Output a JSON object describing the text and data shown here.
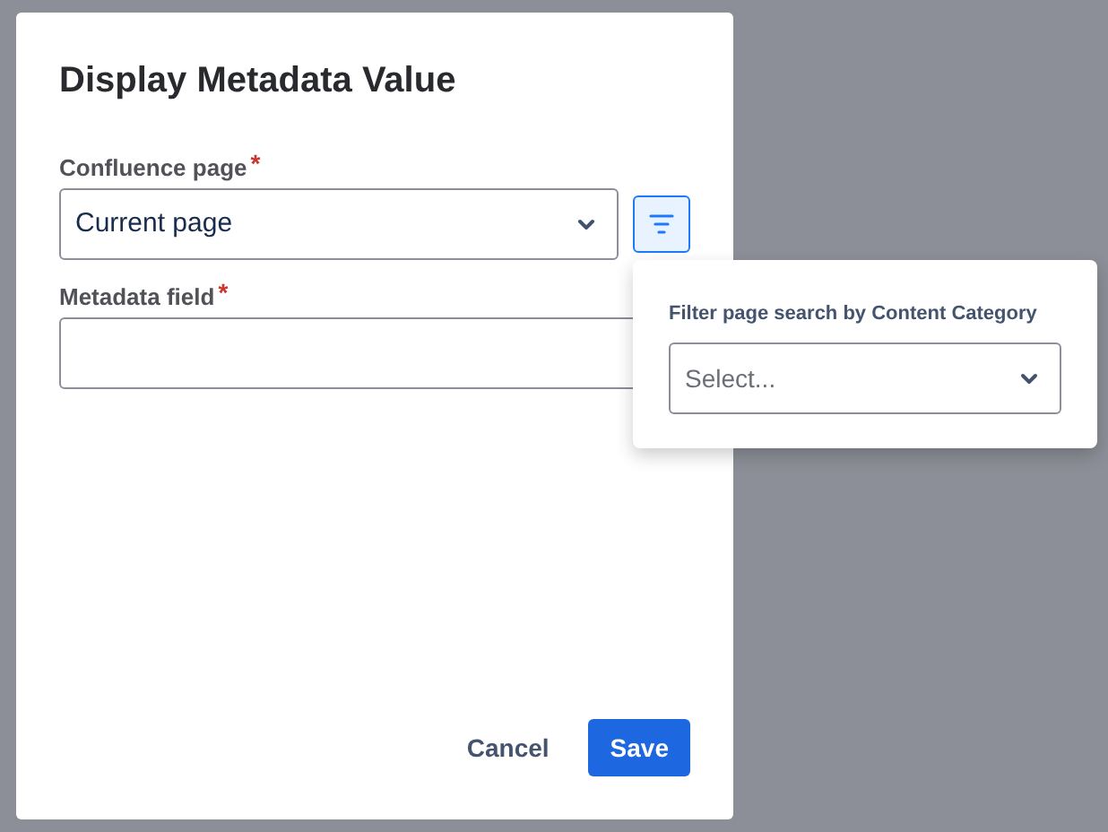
{
  "dialog": {
    "title": "Display Metadata Value",
    "fields": [
      {
        "label": "Confluence page",
        "required_mark": "*",
        "kind": "select",
        "value": "Current page"
      },
      {
        "label": "Metadata field",
        "required_mark": "*",
        "kind": "text"
      }
    ],
    "filter_button": {
      "selected": true
    },
    "buttons": [
      {
        "label": "Cancel",
        "kind": "subtle"
      },
      {
        "label": "Save",
        "kind": "primary"
      }
    ]
  },
  "popover": {
    "label": "Filter page search by Content Category",
    "placeholder": "Select..."
  }
}
